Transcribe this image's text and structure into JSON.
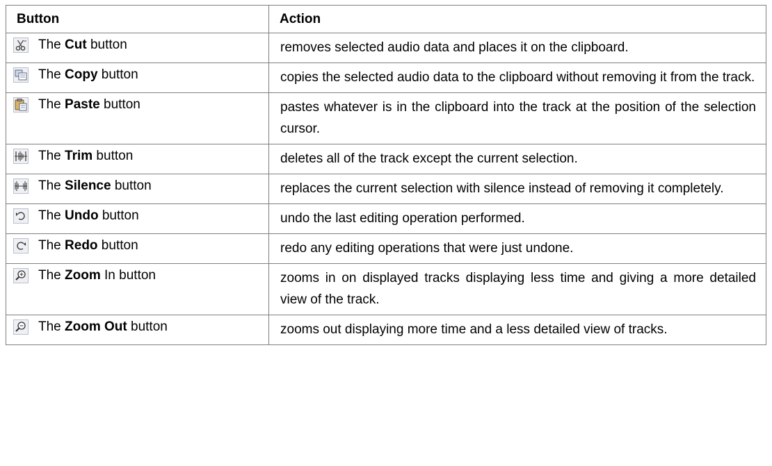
{
  "table": {
    "headers": {
      "button": "Button",
      "action": "Action"
    },
    "rows": [
      {
        "icon": "cut-icon",
        "prefix": "The ",
        "name": "Cut",
        "suffix": " button",
        "action": "removes selected audio data and places it on the clipboard."
      },
      {
        "icon": "copy-icon",
        "prefix": "The ",
        "name": "Copy",
        "suffix": " button",
        "action": "copies the selected audio data to the clipboard without removing it from the track."
      },
      {
        "icon": "paste-icon",
        "prefix": "The ",
        "name": "Paste",
        "suffix": " button",
        "action": "pastes whatever is in the clipboard into the track at the position of the selection cursor."
      },
      {
        "icon": "trim-icon",
        "prefix": "The ",
        "name": "Trim",
        "suffix": " button",
        "action": "deletes all of the track except the current selection."
      },
      {
        "icon": "silence-icon",
        "prefix": "The ",
        "name": "Silence",
        "suffix": " button",
        "action": "replaces the current selection with silence instead of removing it completely."
      },
      {
        "icon": "undo-icon",
        "prefix": "The ",
        "name": "Undo",
        "suffix": " button",
        "action": "undo the last editing operation performed."
      },
      {
        "icon": "redo-icon",
        "prefix": "The ",
        "name": "Redo",
        "suffix": " button",
        "action": "redo any editing operations that were just undone."
      },
      {
        "icon": "zoom-in-icon",
        "prefix": "The ",
        "name": "Zoom",
        "suffix": " In button",
        "action": "zooms in on displayed tracks displaying less time and giving a more detailed view of the track."
      },
      {
        "icon": "zoom-out-icon",
        "prefix": "The ",
        "name": "Zoom Out",
        "suffix": " button",
        "action": "zooms out displaying more time and a less detailed view of tracks."
      }
    ]
  }
}
